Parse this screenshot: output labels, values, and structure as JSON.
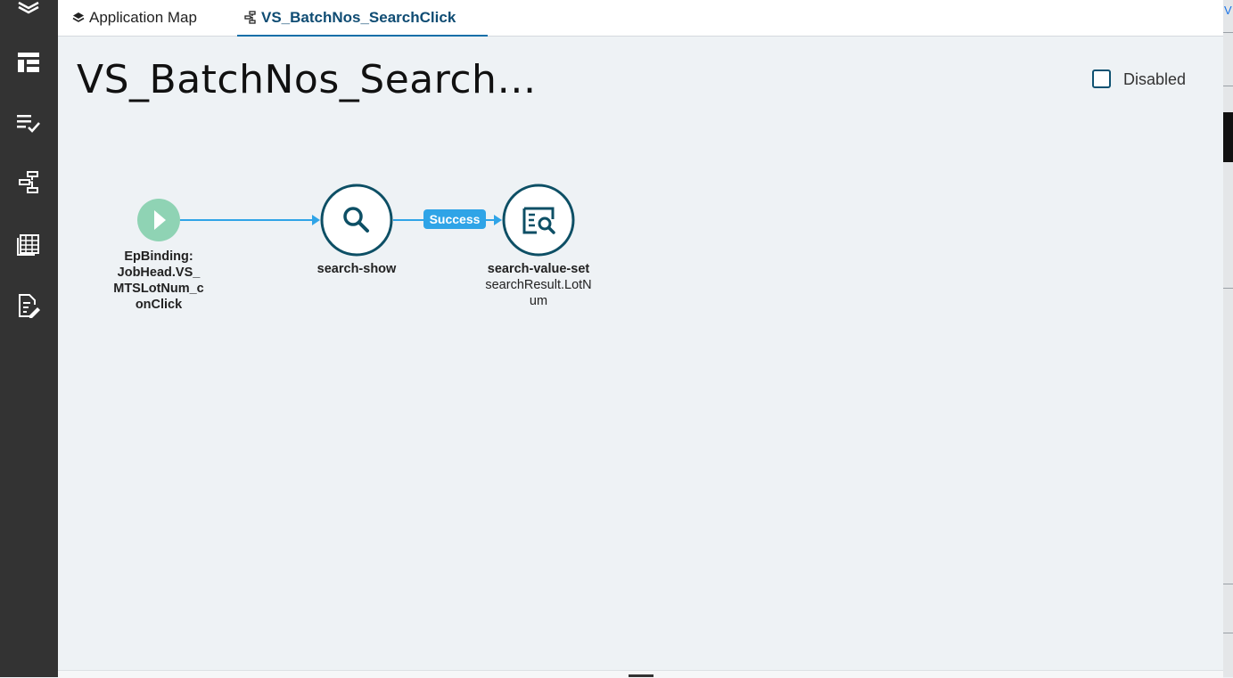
{
  "tabs": [
    {
      "label": "Application Map",
      "icon": "layers-icon"
    },
    {
      "label": "VS_BatchNos_SearchClick",
      "icon": "workflow-icon"
    }
  ],
  "page": {
    "title": "VS_BatchNos_Search…"
  },
  "disabled_checkbox": {
    "label": "Disabled",
    "checked": false
  },
  "flow": {
    "start": {
      "lines": [
        "EpBinding:",
        "JobHead.VS_",
        "MTSLotNum_c",
        "onClick"
      ],
      "color": "#8fd3b4"
    },
    "node1": {
      "label": "search-show",
      "icon": "search-icon"
    },
    "edge_label": "Success",
    "node2": {
      "label": "search-value-set",
      "lines": [
        "searchResult.LotN",
        "um"
      ],
      "icon": "search-result-icon"
    }
  },
  "sidebar": {
    "icons": [
      "layers-icon",
      "layout-icon",
      "checklist-icon",
      "workflow-icon",
      "grid-icon",
      "edit-doc-icon"
    ]
  },
  "right_strip": {
    "char": "V"
  },
  "colors": {
    "accent": "#0f4c73",
    "edge": "#2fa4e7",
    "start": "#8fd3b4",
    "node_border": "#0d4f65"
  }
}
